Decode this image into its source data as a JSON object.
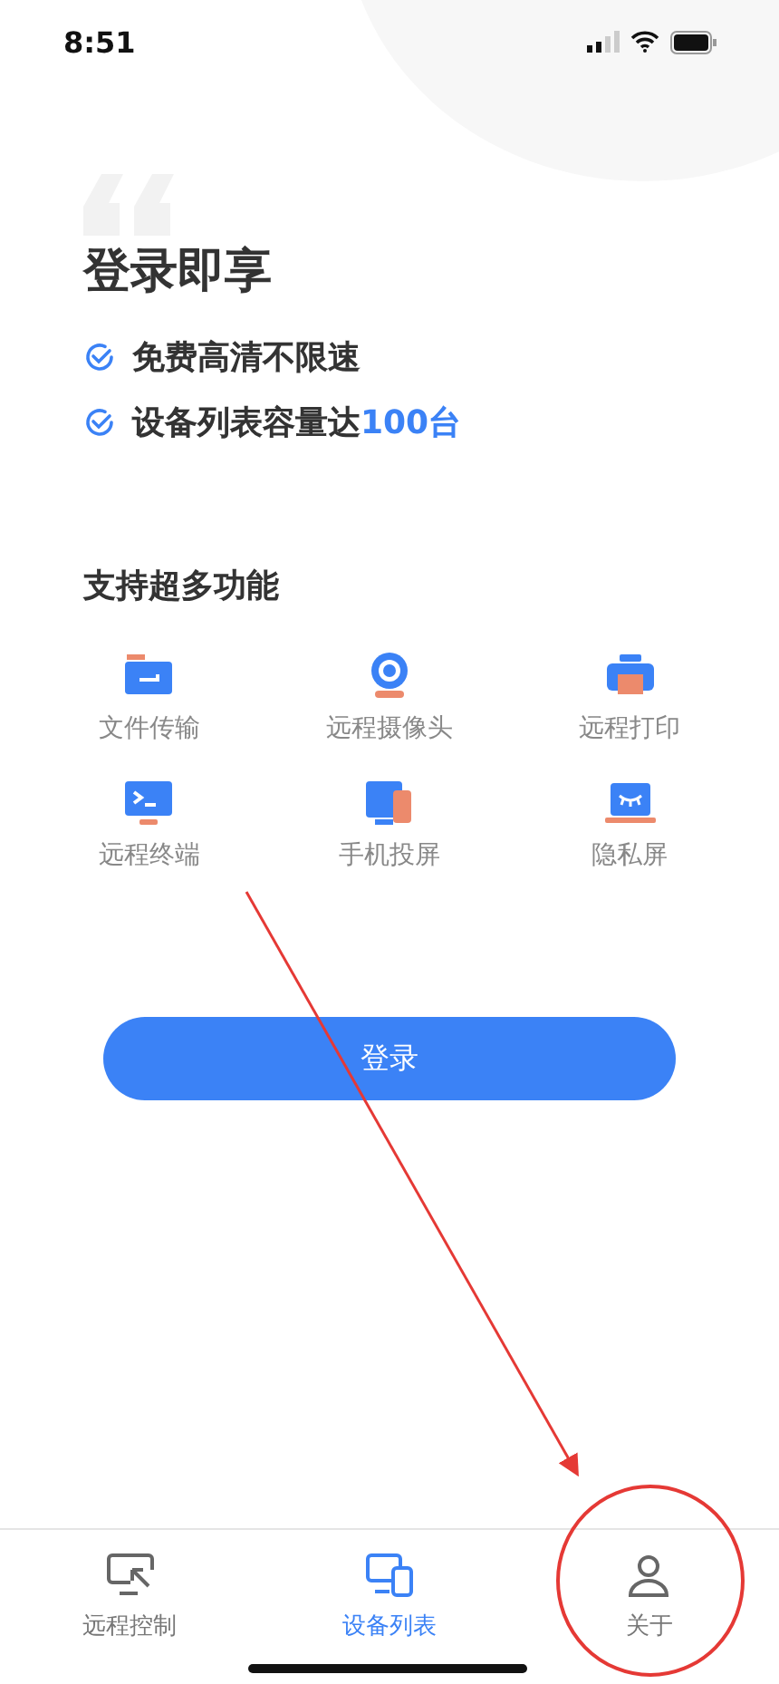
{
  "status_bar": {
    "time": "8:51"
  },
  "title": "登录即享",
  "benefits": [
    {
      "text": "免费高清不限速"
    },
    {
      "text": "设备列表容量达",
      "highlight": "100台"
    }
  ],
  "features_heading": "支持超多功能",
  "features": [
    {
      "kind": "folder",
      "label": "文件传输"
    },
    {
      "kind": "camera",
      "label": "远程摄像头"
    },
    {
      "kind": "printer",
      "label": "远程打印"
    },
    {
      "kind": "terminal",
      "label": "远程终端"
    },
    {
      "kind": "phone",
      "label": "手机投屏"
    },
    {
      "kind": "privacy",
      "label": "隐私屏"
    }
  ],
  "login_button": "登录",
  "tabs": [
    {
      "kind": "remote",
      "label": "远程控制",
      "selected": false
    },
    {
      "kind": "devices",
      "label": "设备列表",
      "selected": true
    },
    {
      "kind": "profile",
      "label": "关于",
      "selected": false
    }
  ]
}
